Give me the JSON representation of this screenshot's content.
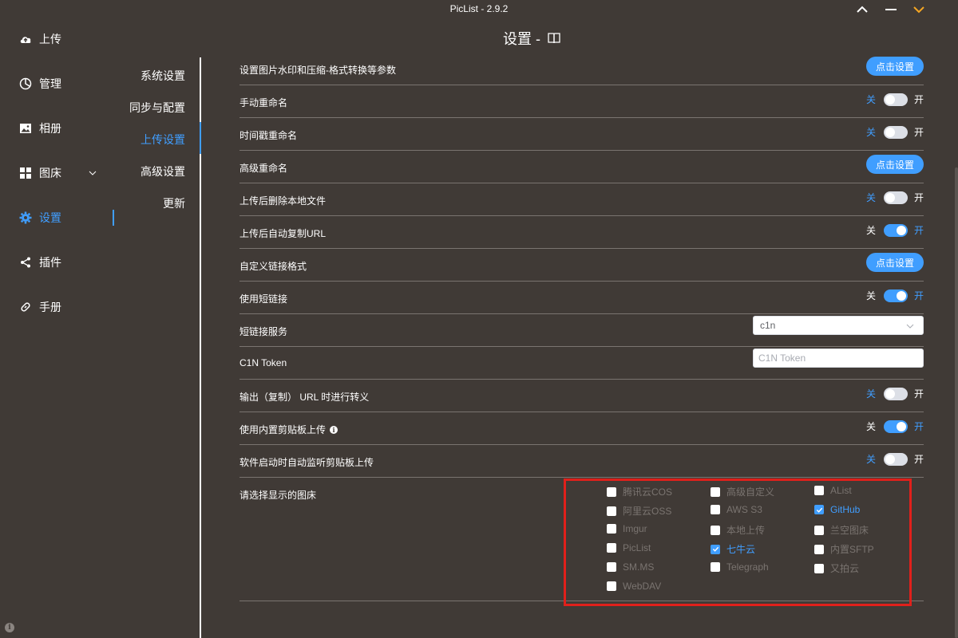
{
  "window": {
    "title": "PicList - 2.9.2",
    "controls": [
      "pin-icon",
      "minimize-icon",
      "collapse-icon"
    ],
    "accent_collapse": "#f5a623"
  },
  "sidebar": {
    "items": [
      {
        "label": "上传",
        "icon": "upload-cloud-icon"
      },
      {
        "label": "管理",
        "icon": "pie-chart-icon"
      },
      {
        "label": "相册",
        "icon": "image-icon"
      },
      {
        "label": "图床",
        "icon": "grid-icon"
      },
      {
        "label": "设置",
        "icon": "gear-icon",
        "active": true
      },
      {
        "label": "插件",
        "icon": "share-icon"
      },
      {
        "label": "手册",
        "icon": "link-icon"
      }
    ]
  },
  "subnav": {
    "items": [
      {
        "label": "系统设置"
      },
      {
        "label": "同步与配置"
      },
      {
        "label": "上传设置",
        "active": true
      },
      {
        "label": "高级设置"
      },
      {
        "label": "更新"
      }
    ]
  },
  "page": {
    "title": "设置 -",
    "title_icon": "book-icon"
  },
  "labels": {
    "off": "关",
    "on": "开",
    "set_button": "点击设置"
  },
  "settings": {
    "watermark": {
      "label": "设置图片水印和压缩-格式转换等参数"
    },
    "manual_rename": {
      "label": "手动重命名",
      "value": false
    },
    "timestamp_rename": {
      "label": "时间戳重命名",
      "value": false
    },
    "advanced_rename": {
      "label": "高级重命名"
    },
    "delete_local": {
      "label": "上传后删除本地文件",
      "value": false
    },
    "auto_copy_url": {
      "label": "上传后自动复制URL",
      "value": true
    },
    "custom_link": {
      "label": "自定义链接格式"
    },
    "short_link": {
      "label": "使用短链接",
      "value": true
    },
    "short_link_service": {
      "label": "短链接服务",
      "value": "c1n"
    },
    "c1n_token": {
      "label": "C1N Token",
      "placeholder": "C1N Token"
    },
    "escape_url": {
      "label": "输出（复制） URL 时进行转义",
      "value": false
    },
    "builtin_clipboard": {
      "label": "使用内置剪贴板上传",
      "value": true
    },
    "auto_clipboard": {
      "label": "软件启动时自动监听剪贴板上传",
      "value": false
    },
    "picbeds": {
      "label": "请选择显示的图床",
      "options": [
        {
          "label": "腾讯云COS",
          "checked": false
        },
        {
          "label": "高级自定义",
          "checked": false
        },
        {
          "label": "AList",
          "checked": false
        },
        {
          "label": "阿里云OSS",
          "checked": false
        },
        {
          "label": "AWS S3",
          "checked": false
        },
        {
          "label": "GitHub",
          "checked": true
        },
        {
          "label": "Imgur",
          "checked": false
        },
        {
          "label": "本地上传",
          "checked": false
        },
        {
          "label": "兰空图床",
          "checked": false
        },
        {
          "label": "PicList",
          "checked": false
        },
        {
          "label": "七牛云",
          "checked": true
        },
        {
          "label": "内置SFTP",
          "checked": false
        },
        {
          "label": "SM.MS",
          "checked": false
        },
        {
          "label": "Telegraph",
          "checked": false
        },
        {
          "label": "又拍云",
          "checked": false
        },
        {
          "label": "WebDAV",
          "checked": false
        }
      ]
    }
  },
  "colors": {
    "background": "#403a36",
    "accent": "#409eff",
    "highlight": "#e0201b"
  }
}
